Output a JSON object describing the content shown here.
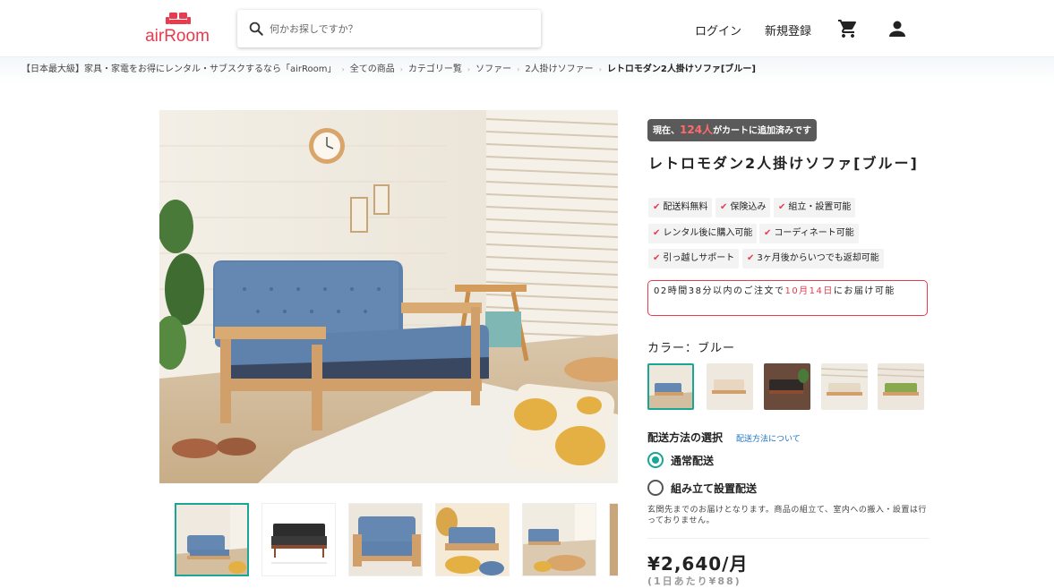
{
  "header": {
    "logo_text": "airRoom",
    "search_placeholder": "何かお探しですか？",
    "login": "ログイン",
    "signup": "新規登録"
  },
  "breadcrumb": [
    "【日本最大級】家具・家電をお得にレンタル・サブスクするなら「airRoom」",
    "全ての商品",
    "カテゴリー覧",
    "ソファー",
    "2人掛けソファー",
    "レトロモダン2人掛けソファ[ブルー]"
  ],
  "product": {
    "cart_prefix": "現在、",
    "cart_count": "124人",
    "cart_suffix": "がカートに追加済みです",
    "title": "レトロモダン2人掛けソファ[ブルー]",
    "tags": [
      "配送料無料",
      "保険込み",
      "組立・設置可能",
      "レンタル後に購入可能",
      "コーディネート可能",
      "引っ越しサポート",
      "3ヶ月後からいつでも返却可能"
    ],
    "delivery_prefix": "02時間38分以内のご注文で",
    "delivery_date": "10月14日",
    "delivery_suffix": "にお届け可能",
    "color_label": "カラー：ブルー",
    "colors": [
      "blue",
      "beige",
      "dark-brown",
      "light-beige",
      "green"
    ],
    "shipping_label": "配送方法の選択",
    "shipping_link": "配送方法について",
    "shipping_options": [
      "通常配送",
      "組み立て設置配送"
    ],
    "shipping_selected": 0,
    "shipping_note": "玄関先までのお届けとなります。商品の組立て、室内への搬入・設置は行っておりません。",
    "price": "¥2,640/月",
    "per_day": "(1日あたり¥88)"
  },
  "colors": {
    "accent": "#1aa597",
    "brand": "#e83b4d",
    "link": "#1a73c9"
  }
}
